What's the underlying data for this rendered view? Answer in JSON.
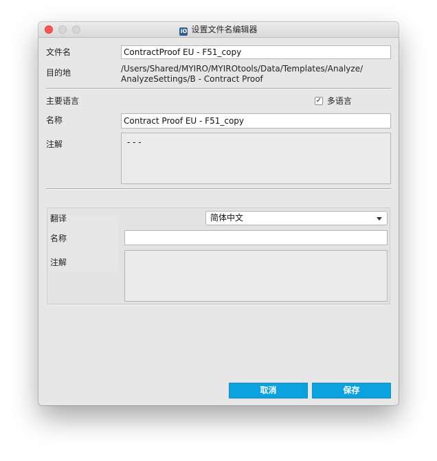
{
  "window": {
    "title": "设置文件名编辑器",
    "app_icon_text": "iO"
  },
  "file": {
    "filename_label": "文件名",
    "filename_value": "ContractProof EU - F51_copy",
    "destination_label": "目的地",
    "destination_line1": "/Users/Shared/MYIRO/MYIROtools/Data/Templates/Analyze/",
    "destination_line2": "AnalyzeSettings/B - Contract Proof"
  },
  "primary": {
    "language_label": "主要语言",
    "multilang_label": "多语言",
    "multilang_checked": true,
    "check_glyph": "✓",
    "name_label": "名称",
    "name_value": "Contract Proof EU - F51_copy",
    "note_label": "注解",
    "note_value": "- - -"
  },
  "translation": {
    "translate_label": "翻译",
    "language_selected": "简体中文",
    "name_label": "名称",
    "name_value": "",
    "note_label": "注解",
    "note_value": ""
  },
  "buttons": {
    "cancel": "取消",
    "save": "保存"
  },
  "colors": {
    "accent": "#0aa3df",
    "close": "#fc5753"
  }
}
